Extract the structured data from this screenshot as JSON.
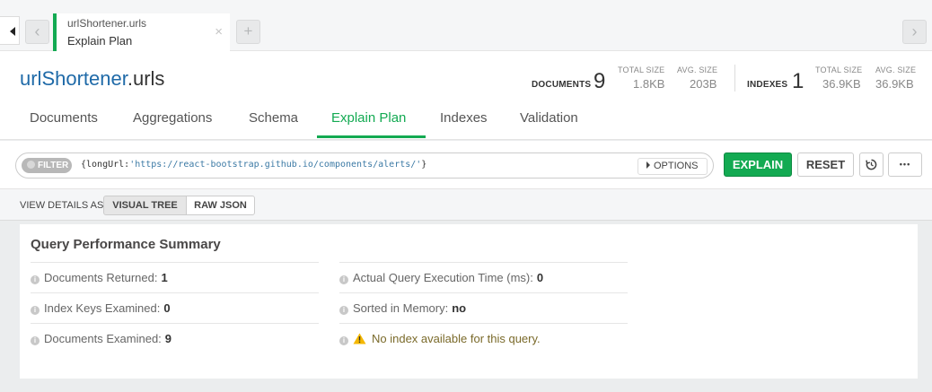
{
  "tabbar": {
    "tab_namespace": "urlShortener.urls",
    "tab_subtitle": "Explain Plan",
    "close_glyph": "×",
    "plus_glyph": "+",
    "prev_glyph": "‹",
    "next_glyph": "›"
  },
  "header": {
    "db_name": "urlShortener",
    "collection_name": ".urls",
    "documents_label": "DOCUMENTS",
    "documents_count": "9",
    "doc_total_size_label": "TOTAL SIZE",
    "doc_total_size": "1.8KB",
    "doc_avg_size_label": "AVG. SIZE",
    "doc_avg_size": "203B",
    "indexes_label": "INDEXES",
    "indexes_count": "1",
    "idx_total_size_label": "TOTAL SIZE",
    "idx_total_size": "36.9KB",
    "idx_avg_size_label": "AVG. SIZE",
    "idx_avg_size": "36.9KB"
  },
  "nav": {
    "tabs": [
      {
        "label": "Documents"
      },
      {
        "label": "Aggregations"
      },
      {
        "label": "Schema"
      },
      {
        "label": "Explain Plan",
        "active": true
      },
      {
        "label": "Indexes"
      },
      {
        "label": "Validation"
      }
    ]
  },
  "query": {
    "filter_label": "FILTER",
    "filter_key": "{longUrl:",
    "filter_value": "'https://react-bootstrap.github.io/components/alerts/'",
    "filter_close": "}",
    "options_label": "OPTIONS",
    "explain_label": "EXPLAIN",
    "reset_label": "RESET",
    "more_label": "•••"
  },
  "view": {
    "label": "VIEW DETAILS AS",
    "visual_tree_label": "VISUAL TREE",
    "raw_json_label": "RAW JSON"
  },
  "summary": {
    "title": "Query Performance Summary",
    "docs_returned_label": "Documents Returned:",
    "docs_returned_value": "1",
    "index_keys_label": "Index Keys Examined:",
    "index_keys_value": "0",
    "docs_examined_label": "Documents Examined:",
    "docs_examined_value": "9",
    "exec_time_label": "Actual Query Execution Time (ms):",
    "exec_time_value": "0",
    "sorted_label": "Sorted in Memory:",
    "sorted_value": "no",
    "no_index_text": "No index available for this query."
  },
  "colors": {
    "accent_green": "#13aa52",
    "db_blue": "#1f6aa8",
    "warning_yellow": "#f5b800"
  },
  "icons": [
    "sidebar-toggle-icon",
    "back-arrow-icon",
    "forward-arrow-icon",
    "close-icon",
    "plus-icon",
    "caret-right-icon",
    "history-icon",
    "ellipsis-icon",
    "info-icon",
    "warning-icon"
  ]
}
